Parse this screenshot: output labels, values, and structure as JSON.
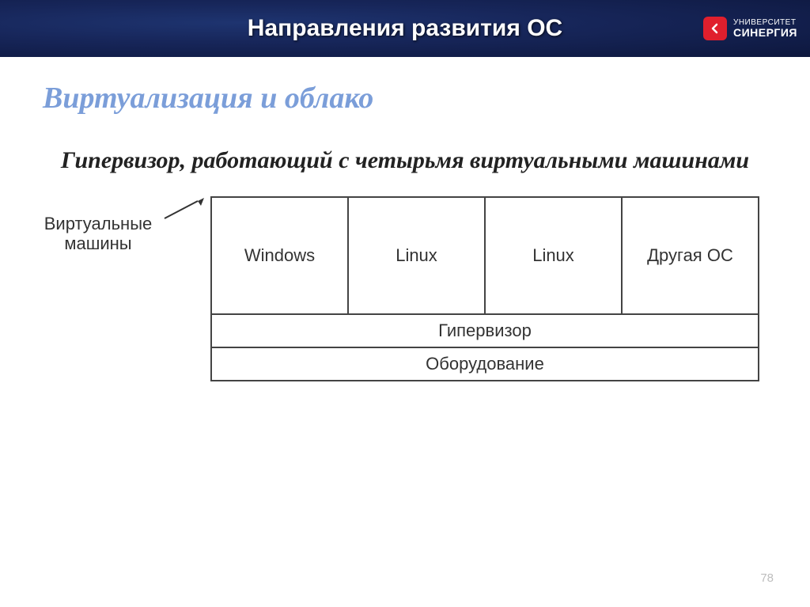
{
  "header": {
    "title": "Направления развития ОС",
    "brand_top": "УНИВЕРСИТЕТ",
    "brand_bottom": "СИНЕРГИЯ"
  },
  "content": {
    "section_title": "Виртуализация и облако",
    "caption": "Гипервизор, работающий с четырьмя виртуальными машинами",
    "vm_pointer_label": "Виртуальные машины",
    "vms": [
      "Windows",
      "Linux",
      "Linux",
      "Другая ОС"
    ],
    "layers": [
      "Гипервизор",
      "Оборудование"
    ]
  },
  "slide_number": "78"
}
